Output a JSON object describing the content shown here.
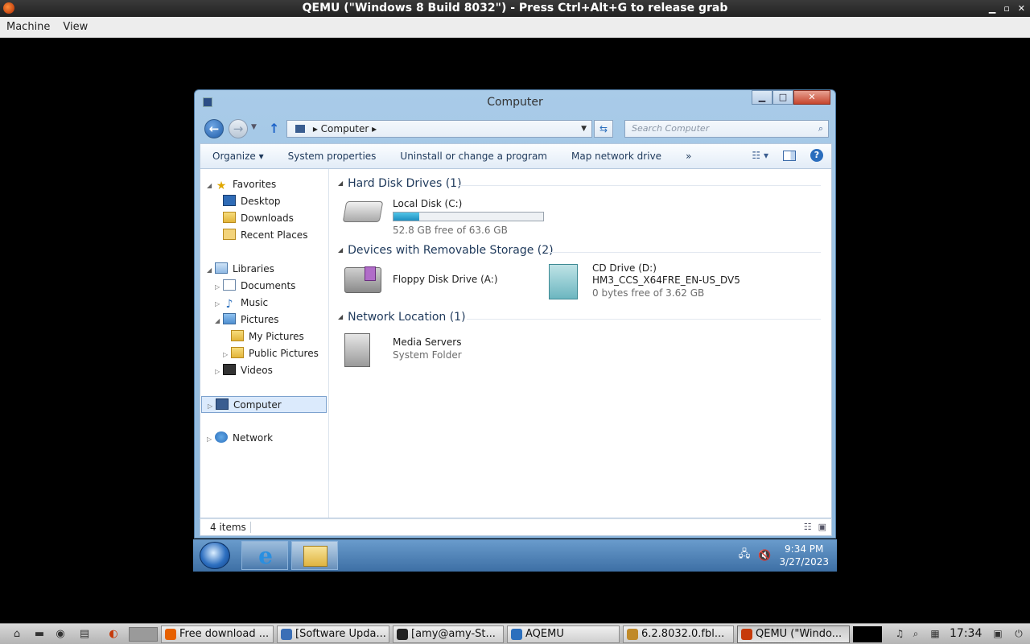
{
  "host": {
    "title": "QEMU (\"Windows 8 Build 8032\") - Press Ctrl+Alt+G to release grab",
    "menu": [
      "Machine",
      "View"
    ],
    "panel": {
      "tasks": [
        {
          "label": "Free download ...",
          "icon": "firefox-icon",
          "color": "#e66000"
        },
        {
          "label": "[Software Upda...",
          "icon": "software-update-icon",
          "color": "#3b6fb6"
        },
        {
          "label": "[amy@amy-St...",
          "icon": "terminal-icon",
          "color": "#222222"
        },
        {
          "label": "AQEMU",
          "icon": "aqemu-icon",
          "color": "#2b6fbd"
        },
        {
          "label": "6.2.8032.0.fbl...",
          "icon": "archive-icon",
          "color": "#c08a2a"
        },
        {
          "label": "QEMU (\"Windo...",
          "icon": "qemu-icon",
          "color": "#c63a0a"
        }
      ],
      "clock": "17:34"
    }
  },
  "explorer": {
    "title": "Computer",
    "address": "Computer",
    "search_placeholder": "Search Computer",
    "toolbar": {
      "organize": "Organize",
      "system_properties": "System properties",
      "uninstall": "Uninstall or change a program",
      "map_drive": "Map network drive",
      "more": "»"
    },
    "nav": {
      "favorites": "Favorites",
      "desktop": "Desktop",
      "downloads": "Downloads",
      "recent": "Recent Places",
      "libraries": "Libraries",
      "documents": "Documents",
      "music": "Music",
      "pictures": "Pictures",
      "my_pictures": "My Pictures",
      "public_pictures": "Public Pictures",
      "videos": "Videos",
      "computer": "Computer",
      "network": "Network"
    },
    "groups": {
      "hdd": "Hard Disk Drives (1)",
      "removable": "Devices with Removable Storage (2)",
      "network": "Network Location (1)"
    },
    "drives": {
      "c_name": "Local Disk (C:)",
      "c_free": "52.8 GB free of 63.6 GB",
      "c_used_fraction": 0.17,
      "floppy_name": "Floppy Disk Drive (A:)",
      "cd_name": "CD Drive (D:)",
      "cd_label": "HM3_CCS_X64FRE_EN-US_DV5",
      "cd_free": "0 bytes free of 3.62 GB",
      "media_name": "Media Servers",
      "media_type": "System Folder"
    },
    "status": "4 items"
  },
  "guest_taskbar": {
    "time": "9:34 PM",
    "date": "3/27/2023"
  }
}
